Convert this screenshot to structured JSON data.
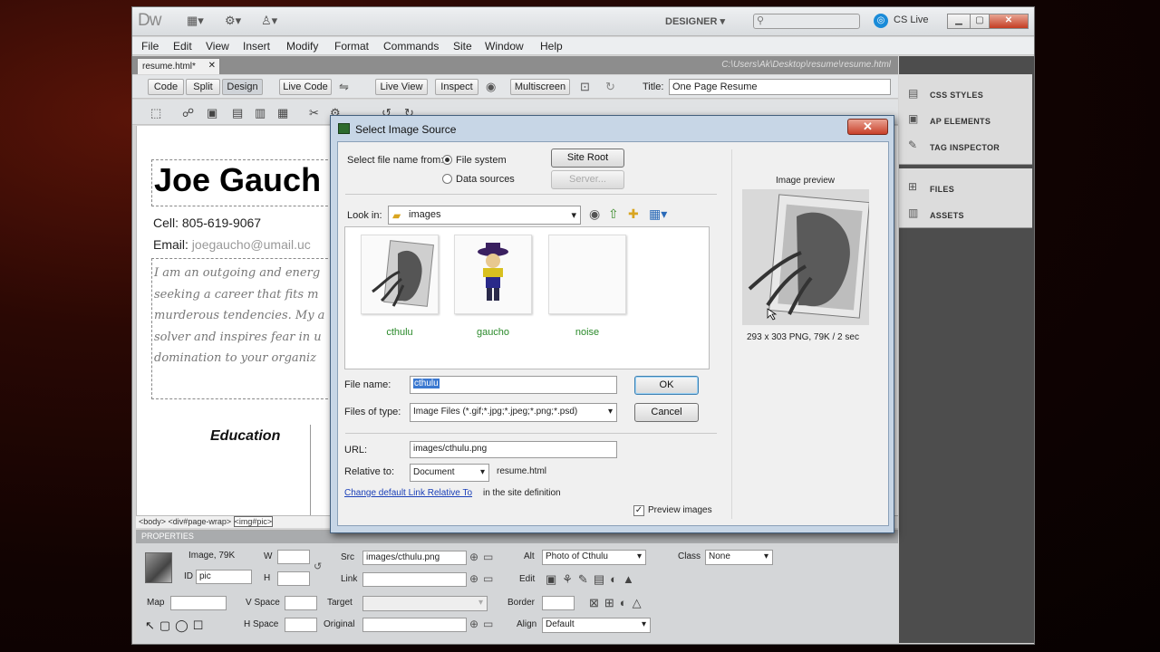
{
  "app": {
    "logo": "Dw",
    "workspace": "DESIGNER",
    "cs_live": "CS Live"
  },
  "menu": [
    "File",
    "Edit",
    "View",
    "Insert",
    "Modify",
    "Format",
    "Commands",
    "Site",
    "Window",
    "Help"
  ],
  "doc": {
    "tab": "resume.html*",
    "path": "C:\\Users\\Ak\\Desktop\\resume\\resume.html",
    "title_label": "Title:",
    "title_value": "One Page Resume"
  },
  "doc_toolbar": {
    "code": "Code",
    "split": "Split",
    "design": "Design",
    "live_code": "Live Code",
    "live_view": "Live View",
    "inspect": "Inspect",
    "multiscreen": "Multiscreen"
  },
  "page": {
    "name": "Joe Gauch",
    "cell": "Cell: 805-619-9067",
    "email_label": "Email:",
    "email": "joegaucho@umail.uc",
    "para": [
      "I am an outgoing and energ",
      "seeking a career that fits m",
      "murderous tendencies. My a",
      "solver and inspires fear in u",
      "domination to your organiz"
    ],
    "education": "Education"
  },
  "tag_selector": [
    "<body>",
    "<div#page-wrap>",
    "<img#pic>"
  ],
  "panels": [
    "CSS STYLES",
    "AP ELEMENTS",
    "TAG INSPECTOR",
    "FILES",
    "ASSETS"
  ],
  "properties": {
    "header": "PROPERTIES",
    "type": "Image, 79K",
    "id_label": "ID",
    "id": "pic",
    "w": "W",
    "h": "H",
    "src_label": "Src",
    "src": "images/cthulu.png",
    "link": "Link",
    "alt_label": "Alt",
    "alt": "Photo of Cthulu",
    "class_label": "Class",
    "class": "None",
    "edit": "Edit",
    "map": "Map",
    "vspace": "V Space",
    "target": "Target",
    "border": "Border",
    "hspace": "H Space",
    "original": "Original",
    "align_label": "Align",
    "align": "Default"
  },
  "dialog": {
    "title": "Select Image Source",
    "select_from": "Select file name from:",
    "file_system": "File system",
    "data_sources": "Data sources",
    "site_root": "Site Root",
    "server": "Server...",
    "look_in": "Look in:",
    "folder": "images",
    "files": [
      {
        "name": "cthulu"
      },
      {
        "name": "gaucho"
      },
      {
        "name": "noise"
      }
    ],
    "file_name_label": "File name:",
    "file_name": "cthulu",
    "files_of_type_label": "Files of type:",
    "files_of_type": "Image Files (*.gif;*.jpg;*.jpeg;*.png;*.psd)",
    "ok": "OK",
    "cancel": "Cancel",
    "url_label": "URL:",
    "url": "images/cthulu.png",
    "relative_label": "Relative to:",
    "relative": "Document",
    "relative_file": "resume.html",
    "change_link": "Change default Link Relative To",
    "change_suffix": "in the site definition",
    "preview_images": "Preview images",
    "preview_heading": "Image preview",
    "preview_info": "293 x 303 PNG, 79K / 2 sec"
  }
}
